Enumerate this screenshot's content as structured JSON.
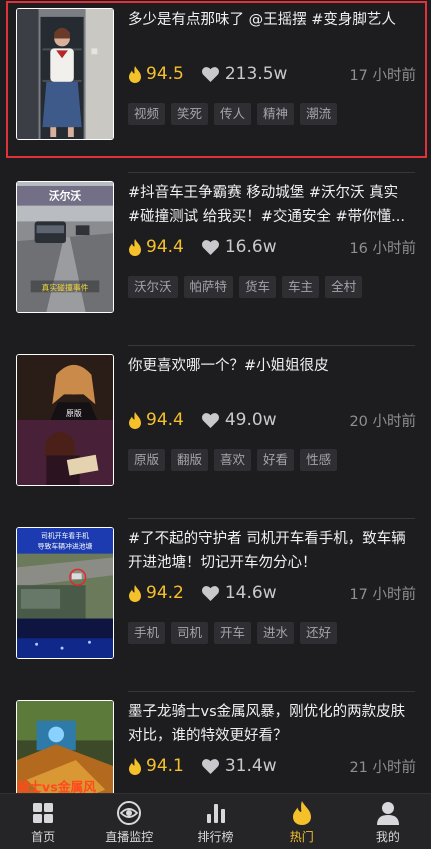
{
  "feed": {
    "items": [
      {
        "title": "多少是有点那味了 @王摇摆 #变身脚艺人",
        "heat": "94.5",
        "likes": "213.5w",
        "time": "17 小时前",
        "tags": [
          "视频",
          "笑死",
          "传人",
          "精神",
          "潮流"
        ],
        "selected": true
      },
      {
        "title": "#抖音车王争霸赛 移动城堡 #沃尔沃 真实 #碰撞测试 给我买！#交通安全 #带你懂...",
        "heat": "94.4",
        "likes": "16.6w",
        "time": "16 小时前",
        "tags": [
          "沃尔沃",
          "帕萨特",
          "货车",
          "车主",
          "全村"
        ],
        "thumb_text": [
          "沃尔沃",
          "真实碰撞事件"
        ]
      },
      {
        "title": "你更喜欢哪一个？#小姐姐很皮",
        "heat": "94.4",
        "likes": "49.0w",
        "time": "20 小时前",
        "tags": [
          "原版",
          "翻版",
          "喜欢",
          "好看",
          "性感"
        ],
        "thumb_text": [
          "原版"
        ]
      },
      {
        "title": "#了不起的守护者 司机开车看手机，致车辆开进池塘！切记开车勿分心！",
        "heat": "94.2",
        "likes": "14.6w",
        "time": "17 小时前",
        "tags": [
          "手机",
          "司机",
          "开车",
          "进水",
          "还好"
        ],
        "thumb_text": [
          "司机开车看手机",
          "导致车辆冲进池塘"
        ]
      },
      {
        "title": "墨子龙骑士vs金属风暴，刚优化的两款皮肤对比，谁的特效更好看？",
        "heat": "94.1",
        "likes": "31.4w",
        "time": "21 小时前",
        "tags": [],
        "thumb_text": [
          "骑士vs金属风"
        ]
      }
    ]
  },
  "tabbar": {
    "tabs": [
      {
        "label": "首页",
        "icon": "home-grid-icon"
      },
      {
        "label": "直播监控",
        "icon": "eye-icon"
      },
      {
        "label": "排行榜",
        "icon": "bar-chart-icon"
      },
      {
        "label": "热门",
        "icon": "flame-icon",
        "active": true
      },
      {
        "label": "我的",
        "icon": "user-icon"
      }
    ]
  },
  "colors": {
    "background": "#1d1d20",
    "accent": "#f5c12b",
    "selection_border": "#e0323a"
  }
}
